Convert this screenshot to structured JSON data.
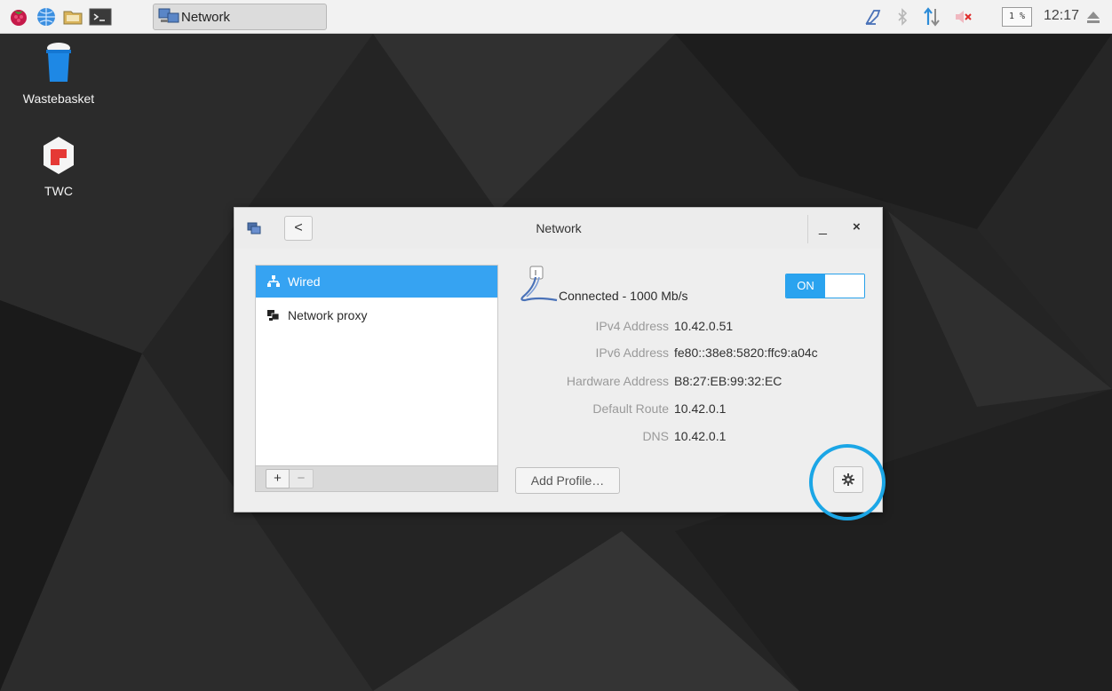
{
  "taskbar": {
    "task_label": "Network",
    "cpu": "1 %",
    "clock": "12:17"
  },
  "desktop": {
    "items": [
      {
        "label": "Wastebasket",
        "icon": "wastebasket-icon"
      },
      {
        "label": "TWC",
        "icon": "twc-app-icon"
      }
    ]
  },
  "window": {
    "title": "Network",
    "back_label": "<",
    "minimize_label": "_",
    "close_label": "×",
    "sidebar": {
      "items": [
        {
          "label": "Wired",
          "icon": "wired-network-icon",
          "selected": true
        },
        {
          "label": "Network proxy",
          "icon": "network-proxy-icon",
          "selected": false
        }
      ],
      "add_label": "+",
      "remove_label": "−"
    },
    "details": {
      "status": "Connected - 1000 Mb/s",
      "toggle_label": "ON",
      "rows": [
        {
          "key": "IPv4 Address",
          "value": "10.42.0.51"
        },
        {
          "key": "IPv6 Address",
          "value": "fe80::38e8:5820:ffc9:a04c"
        },
        {
          "key": "Hardware Address",
          "value": "B8:27:EB:99:32:EC"
        },
        {
          "key": "Default Route",
          "value": "10.42.0.1"
        },
        {
          "key": "DNS",
          "value": "10.42.0.1"
        }
      ],
      "add_profile_label": "Add Profile…"
    }
  },
  "colors": {
    "accent": "#36a3f2",
    "highlight": "#1ba6e6"
  }
}
